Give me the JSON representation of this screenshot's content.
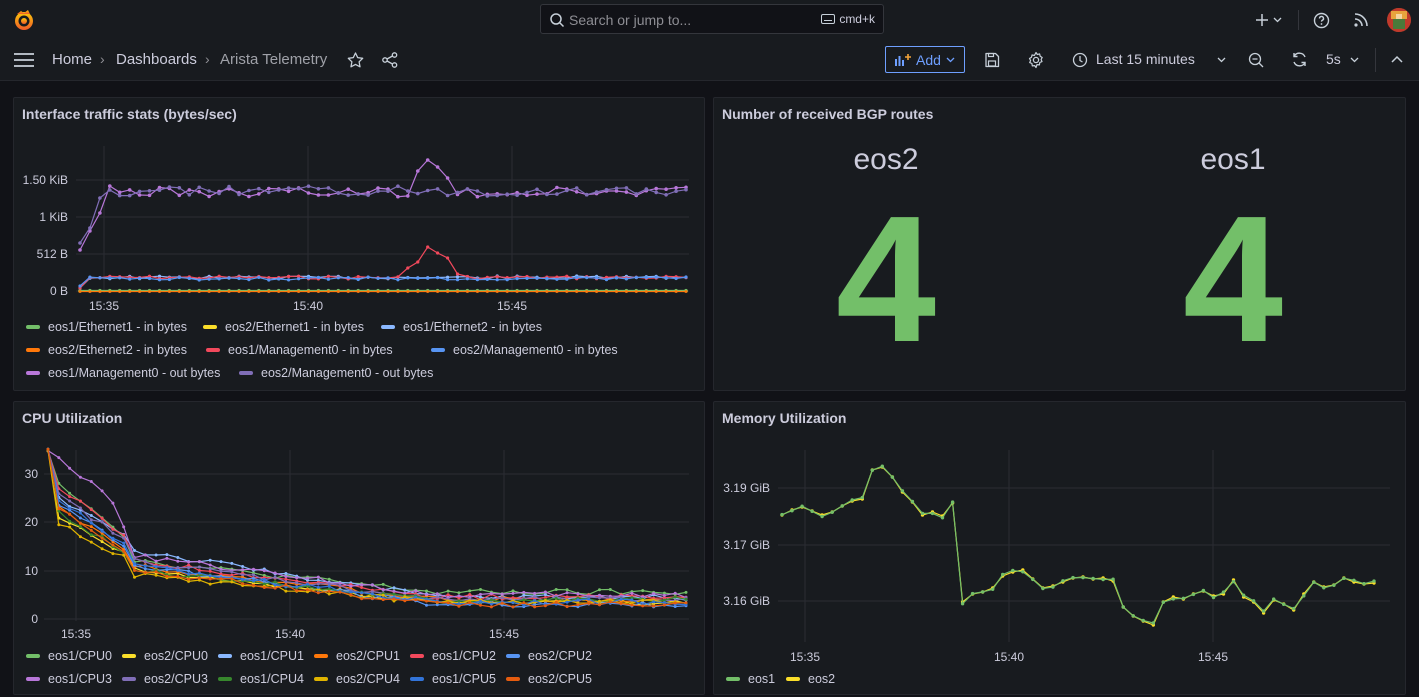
{
  "topbar": {
    "search_placeholder": "Search or jump to...",
    "shortcut": "cmd+k"
  },
  "breadcrumb": {
    "home": "Home",
    "dashboards": "Dashboards",
    "current": "Arista Telemetry"
  },
  "toolbar": {
    "add_label": "Add",
    "time_range": "Last 15 minutes",
    "refresh_interval": "5s"
  },
  "colors": {
    "green": "#73bf69",
    "yellow": "#fade2a",
    "lightblue": "#8ab8ff",
    "orange": "#ff780a",
    "red": "#f2495c",
    "blue": "#5794f2",
    "purple": "#b877d9",
    "darkpurple": "#806eb7",
    "darkgreen": "#37872d",
    "gold": "#e0b400",
    "steelblue": "#3274d9",
    "darkorange": "#e55c0f"
  },
  "panels": {
    "traffic": {
      "title": "Interface traffic stats (bytes/sec)",
      "chart_data": {
        "type": "line",
        "y_ticks": [
          "1.50 KiB",
          "1 KiB",
          "512 B",
          "0 B"
        ],
        "x_ticks": [
          "15:35",
          "15:40",
          "15:45"
        ],
        "ylim": [
          0,
          1800
        ],
        "series": [
          {
            "name": "eos1/Ethernet1 - in bytes",
            "color": "#73bf69"
          },
          {
            "name": "eos2/Ethernet1 - in bytes",
            "color": "#fade2a"
          },
          {
            "name": "eos1/Ethernet2 - in bytes",
            "color": "#8ab8ff"
          },
          {
            "name": "eos2/Ethernet2 - in bytes",
            "color": "#ff780a"
          },
          {
            "name": "eos1/Management0 - in bytes",
            "color": "#f2495c"
          },
          {
            "name": "eos2/Management0 - in bytes",
            "color": "#5794f2"
          },
          {
            "name": "eos1/Management0 - out bytes",
            "color": "#b877d9"
          },
          {
            "name": "eos2/Management0 - out bytes",
            "color": "#806eb7"
          }
        ]
      }
    },
    "bgp": {
      "title": "Number of received BGP routes",
      "stats": [
        {
          "label": "eos2",
          "value": "4"
        },
        {
          "label": "eos1",
          "value": "4"
        }
      ]
    },
    "cpu": {
      "title": "CPU Utilization",
      "chart_data": {
        "type": "line",
        "y_ticks": [
          "30",
          "20",
          "10",
          "0"
        ],
        "x_ticks": [
          "15:35",
          "15:40",
          "15:45"
        ],
        "ylim": [
          0,
          35
        ],
        "series": [
          {
            "name": "eos1/CPU0",
            "color": "#73bf69"
          },
          {
            "name": "eos2/CPU0",
            "color": "#fade2a"
          },
          {
            "name": "eos1/CPU1",
            "color": "#8ab8ff"
          },
          {
            "name": "eos2/CPU1",
            "color": "#ff780a"
          },
          {
            "name": "eos1/CPU2",
            "color": "#f2495c"
          },
          {
            "name": "eos2/CPU2",
            "color": "#5794f2"
          },
          {
            "name": "eos1/CPU3",
            "color": "#b877d9"
          },
          {
            "name": "eos2/CPU3",
            "color": "#806eb7"
          },
          {
            "name": "eos1/CPU4",
            "color": "#37872d"
          },
          {
            "name": "eos2/CPU4",
            "color": "#e0b400"
          },
          {
            "name": "eos1/CPU5",
            "color": "#3274d9"
          },
          {
            "name": "eos2/CPU5",
            "color": "#e55c0f"
          }
        ]
      }
    },
    "memory": {
      "title": "Memory Utilization",
      "chart_data": {
        "type": "line",
        "y_ticks": [
          "3.19 GiB",
          "3.17 GiB",
          "3.16 GiB"
        ],
        "x_ticks": [
          "15:35",
          "15:40",
          "15:45"
        ],
        "series": [
          {
            "name": "eos1",
            "color": "#73bf69"
          },
          {
            "name": "eos2",
            "color": "#fade2a"
          }
        ]
      }
    }
  }
}
